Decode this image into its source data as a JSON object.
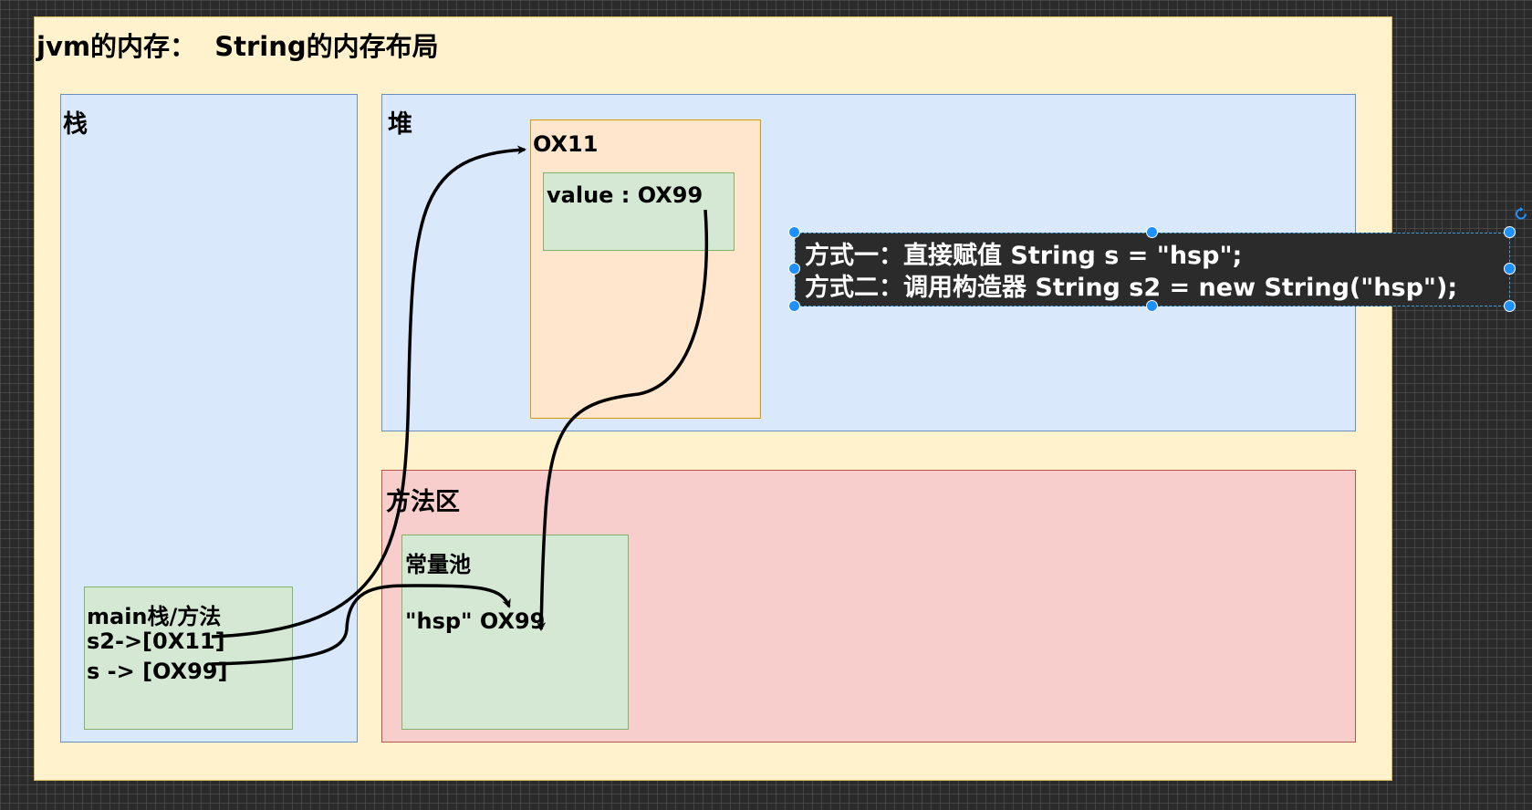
{
  "title": "jvm的内存：  String的内存布局",
  "stack": {
    "label": "栈"
  },
  "heap": {
    "label": "堆",
    "object": {
      "address": "OX11",
      "value": "value : OX99"
    }
  },
  "method_area": {
    "label": "方法区",
    "constant_pool": {
      "label": "常量池",
      "entry": "\"hsp\" OX99"
    }
  },
  "main_frame": {
    "label": "main栈/方法",
    "s2": "s2->[0X11]",
    "s": "s -> [OX99]"
  },
  "note": {
    "line1": "方式一：直接赋值 String s = \"hsp\";",
    "line2": "方式二：调用构造器 String s2 = new String(\"hsp\");"
  },
  "colors": {
    "canvas": "#fff2cc",
    "blue_region": "#dae8fc",
    "red_region": "#f8cecc",
    "orange_box": "#ffe6cc",
    "green_box": "#d5e8d4",
    "note_bg": "#2b2b2b",
    "selection_handle": "#1e90ff"
  }
}
